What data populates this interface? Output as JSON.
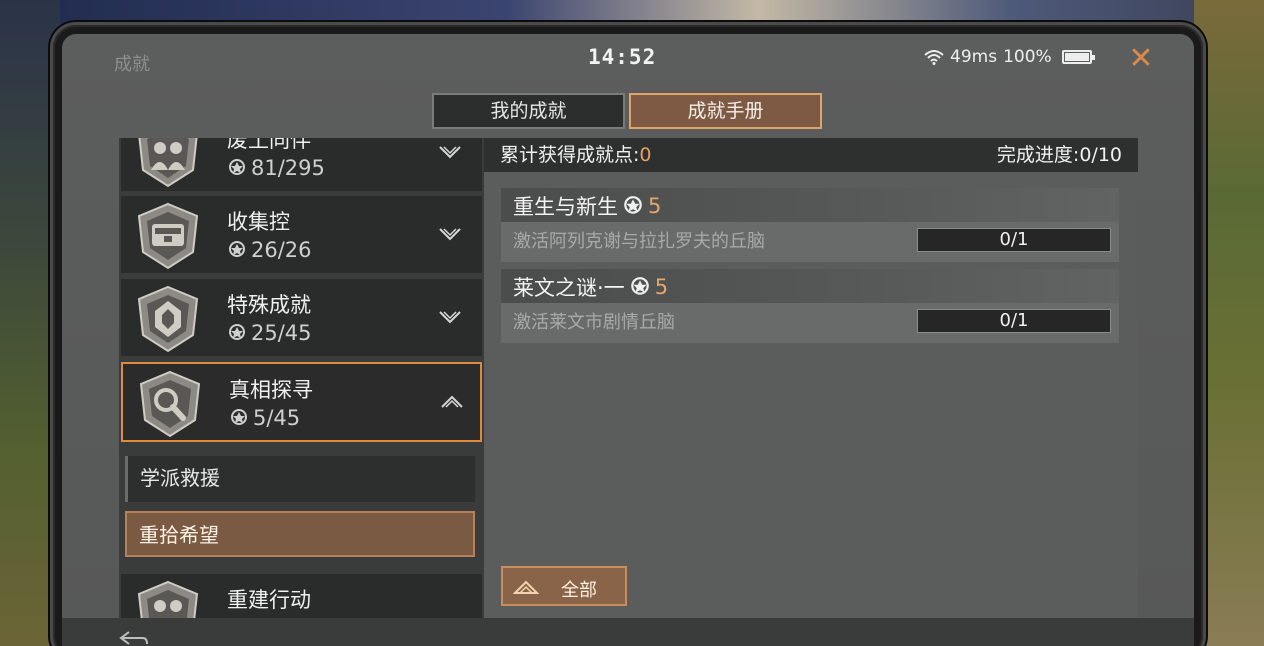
{
  "status": {
    "screen_title": "成就",
    "time": "14:52",
    "ping": "49ms",
    "battery": "100%"
  },
  "tabs": [
    {
      "label": "我的成就",
      "active": false
    },
    {
      "label": "成就手册",
      "active": true
    }
  ],
  "categories": [
    {
      "name": "废土同伴",
      "count": "81/295",
      "icon": "companions-badge-icon"
    },
    {
      "name": "收集控",
      "count": "26/26",
      "icon": "collector-badge-icon"
    },
    {
      "name": "特殊成就",
      "count": "25/45",
      "icon": "special-badge-icon"
    },
    {
      "name": "真相探寻",
      "count": "5/45",
      "icon": "magnifier-badge-icon",
      "expanded": true
    },
    {
      "name": "重建行动",
      "count": "",
      "icon": "rebuild-badge-icon"
    }
  ],
  "subcategories": [
    {
      "label": "学派救援",
      "selected": false
    },
    {
      "label": "重拾希望",
      "selected": true
    }
  ],
  "summary": {
    "points_label": "累计获得成就点:",
    "points_value": "0",
    "progress_label": "完成进度:0/10"
  },
  "achievements": [
    {
      "title": "重生与新生",
      "points": "5",
      "desc": "激活阿列克谢与拉扎罗夫的丘脑",
      "progress": "0/1"
    },
    {
      "title": "莱文之谜·一",
      "points": "5",
      "desc": "激活莱文市剧情丘脑",
      "progress": "0/1"
    }
  ],
  "all_button": "全部",
  "colors": {
    "accent": "#e08a3c",
    "points": "#e6a66a",
    "tab_active_bg": "#7e5a44"
  }
}
